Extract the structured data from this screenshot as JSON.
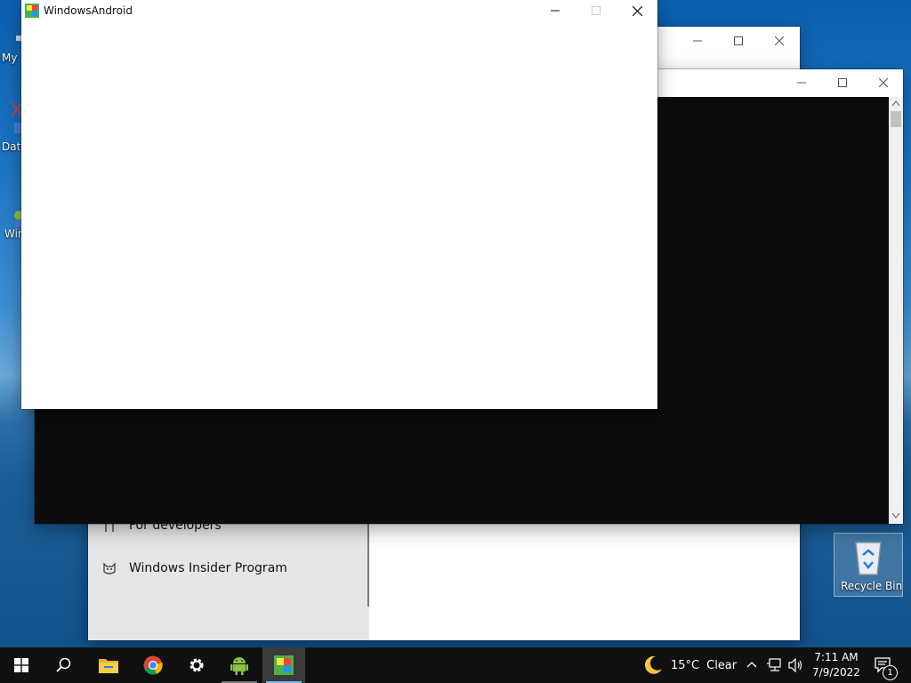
{
  "desktop": {
    "icons": [
      {
        "label": "My"
      },
      {
        "label": "Data"
      },
      {
        "label": "Win"
      }
    ],
    "recycle_bin": {
      "label": "Recycle Bin"
    }
  },
  "windows": {
    "android": {
      "title": "WindowsAndroid"
    },
    "settings": {
      "items": [
        {
          "label": "For developers",
          "icon": "developer-tools-icon"
        },
        {
          "label": "Windows Insider Program",
          "icon": "insider-cat-icon"
        }
      ]
    },
    "console": {
      "title": ""
    }
  },
  "taskbar": {
    "weather": {
      "temp": "15°C",
      "condition": "Clear"
    },
    "clock": {
      "time": "7:11 AM",
      "date": "7/9/2022"
    },
    "notifications_count": "1",
    "colors": {
      "accent": "#76b9ed",
      "background": "#101010"
    }
  }
}
